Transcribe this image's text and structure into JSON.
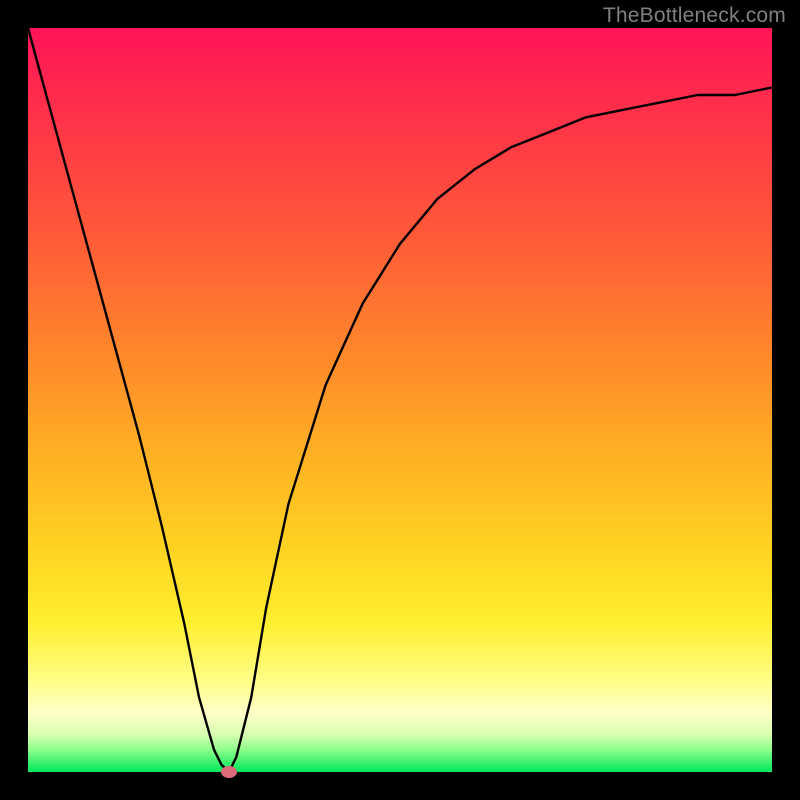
{
  "watermark": "TheBottleneck.com",
  "colors": {
    "background": "#000000",
    "curve_stroke": "#000000",
    "marker_fill": "#dd6b79"
  },
  "chart_data": {
    "type": "line",
    "title": "",
    "xlabel": "",
    "ylabel": "",
    "xlim": [
      0,
      100
    ],
    "ylim": [
      0,
      100
    ],
    "grid": false,
    "legend": false,
    "series": [
      {
        "name": "bottleneck-curve",
        "x": [
          0,
          3,
          6,
          9,
          12,
          15,
          18,
          21,
          23,
          25,
          26,
          27,
          28,
          30,
          32,
          35,
          40,
          45,
          50,
          55,
          60,
          65,
          70,
          75,
          80,
          85,
          90,
          95,
          100
        ],
        "values": [
          100,
          89,
          78,
          67,
          56,
          45,
          33,
          20,
          10,
          3,
          1,
          0,
          2,
          10,
          22,
          36,
          52,
          63,
          71,
          77,
          81,
          84,
          86,
          88,
          89,
          90,
          91,
          91,
          92
        ]
      }
    ],
    "marker": {
      "x": 27,
      "y": 0
    }
  }
}
